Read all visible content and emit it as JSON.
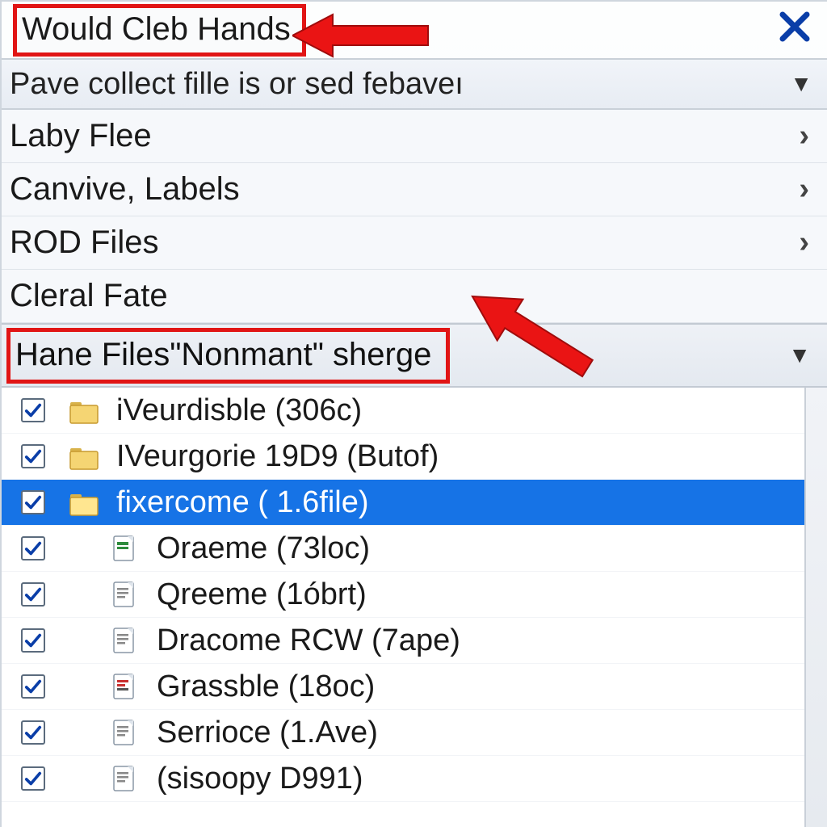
{
  "title": "Would Cleb Hands",
  "dropdown": {
    "label": "Pave collect fille is or sed febaveı"
  },
  "nav": [
    {
      "label": "Laby Flee",
      "has_sub": true
    },
    {
      "label": "Canvive, Labels",
      "has_sub": true
    },
    {
      "label": "ROD Files",
      "has_sub": true
    },
    {
      "label": "Cleral Fate",
      "has_sub": false
    }
  ],
  "section": {
    "label": "Hane Files\"Nonmant\" sherge"
  },
  "files": [
    {
      "checked": true,
      "icon": "folder",
      "indent": false,
      "selected": false,
      "label": "iVeurdisble (306c)"
    },
    {
      "checked": true,
      "icon": "folder",
      "indent": false,
      "selected": false,
      "label": "IVeurgorie 19D9 (Butof)"
    },
    {
      "checked": true,
      "icon": "folder",
      "indent": false,
      "selected": true,
      "label": "fixercome ( 1.6file)"
    },
    {
      "checked": true,
      "icon": "doc-green",
      "indent": true,
      "selected": false,
      "label": "Oraeme (73loc)"
    },
    {
      "checked": true,
      "icon": "doc",
      "indent": true,
      "selected": false,
      "label": "Qreeme (1óbrt)"
    },
    {
      "checked": true,
      "icon": "doc",
      "indent": true,
      "selected": false,
      "label": "Dracome RCW (7ape)"
    },
    {
      "checked": true,
      "icon": "doc-red",
      "indent": true,
      "selected": false,
      "label": "Grassble (18oc)"
    },
    {
      "checked": true,
      "icon": "doc",
      "indent": true,
      "selected": false,
      "label": "Serrioce (1.Ave)"
    },
    {
      "checked": true,
      "icon": "doc",
      "indent": true,
      "selected": false,
      "label": "(sisoopy D991)"
    }
  ],
  "colors": {
    "highlight_red": "#e11515",
    "selection_blue": "#1673e6",
    "close_blue": "#0a3ea8"
  }
}
